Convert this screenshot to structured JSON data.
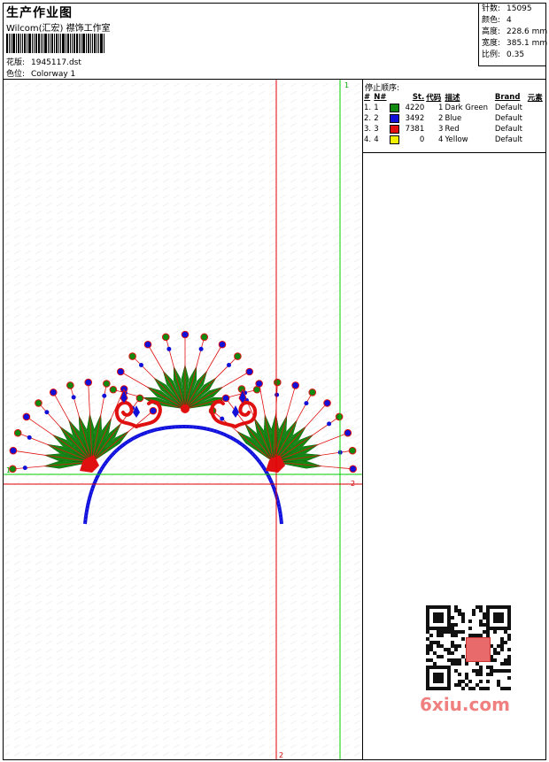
{
  "header": {
    "title": "生产作业图",
    "subtitle": "Wilcom(汇宏) 襟饰工作室",
    "design_label": "花版:",
    "design_value": "1945117.dst",
    "colorway_label": "色位:",
    "colorway_value": "Colorway 1"
  },
  "stats": [
    {
      "label": "针数:",
      "value": "15095"
    },
    {
      "label": "颜色:",
      "value": "4"
    },
    {
      "label": "高度:",
      "value": "228.6 mm"
    },
    {
      "label": "宽度:",
      "value": "385.1 mm"
    },
    {
      "label": "比例:",
      "value": "0.35"
    }
  ],
  "stop_sequence": {
    "title": "停止顺序:",
    "columns": [
      "#",
      "N#",
      "St.",
      "代码",
      "描述",
      "Brand",
      "元素"
    ],
    "rows": [
      {
        "num": "1.",
        "n": "1",
        "color": "#128a12",
        "st": "4220",
        "code": "1",
        "desc": "Dark Green",
        "brand": "Default"
      },
      {
        "num": "2.",
        "n": "2",
        "color": "#1010d8",
        "st": "3492",
        "code": "2",
        "desc": "Blue",
        "brand": "Default"
      },
      {
        "num": "3.",
        "n": "3",
        "color": "#e01010",
        "st": "7381",
        "code": "3",
        "desc": "Red",
        "brand": "Default"
      },
      {
        "num": "4.",
        "n": "4",
        "color": "#f0f000",
        "st": "0",
        "code": "4",
        "desc": "Yellow",
        "brand": "Default"
      }
    ]
  },
  "guides": {
    "green_v": "1",
    "green_h": "1",
    "red_v": "2",
    "red_h": "2"
  },
  "watermark": {
    "text": "6xiu.com"
  },
  "colors": {
    "green": "#128a12",
    "blue": "#1010d8",
    "red": "#e01010",
    "guide_green": "#00cc00",
    "guide_red": "#e00000"
  }
}
